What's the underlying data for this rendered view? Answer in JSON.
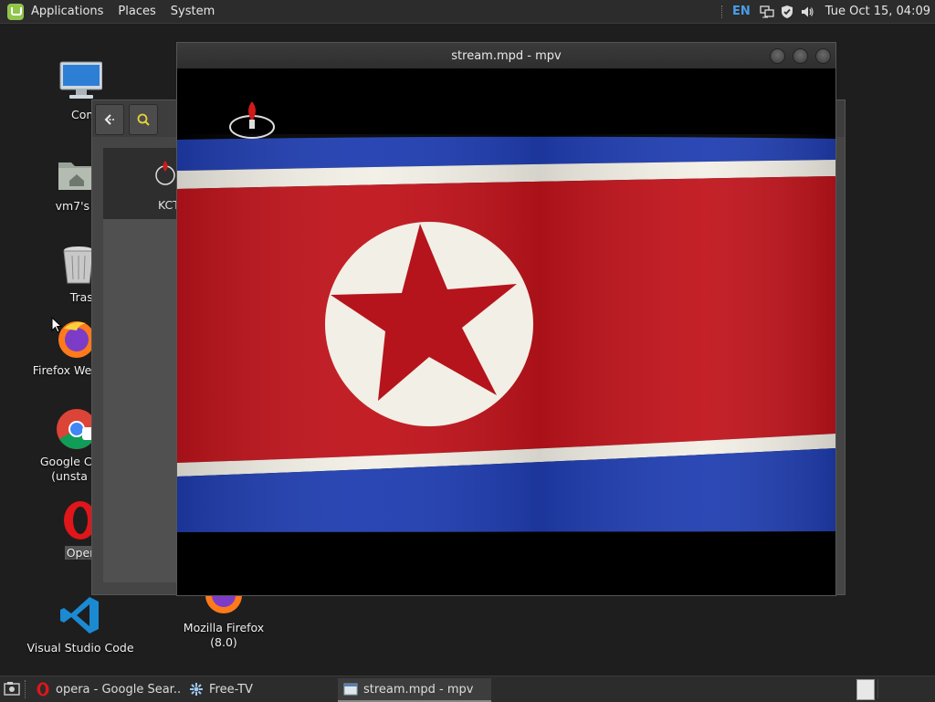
{
  "top_panel": {
    "menus": [
      "Applications",
      "Places",
      "System"
    ],
    "keyboard_layout": "EN",
    "clock": "Tue Oct 15, 04:09"
  },
  "desktop_icons": [
    {
      "label": "Compu",
      "icon": "computer-icon"
    },
    {
      "label": "vm7's H",
      "icon": "home-folder-icon"
    },
    {
      "label": "Trasl",
      "icon": "trash-icon"
    },
    {
      "label": "Firefox Web",
      "icon": "firefox-icon"
    },
    {
      "label": "Google Cl",
      "label2": "(unsta",
      "icon": "chrome-icon"
    },
    {
      "label": "Oper",
      "icon": "opera-icon"
    },
    {
      "label": "Visual Studio Code",
      "icon": "vscode-icon"
    },
    {
      "label": "Mozilla Firefox (8.0)",
      "icon": "firefox-icon"
    }
  ],
  "file_manager": {
    "item_label": "KCT"
  },
  "mpv": {
    "title": "stream.mpd - mpv"
  },
  "taskbar": {
    "items": [
      {
        "label": "opera - Google Sear...",
        "icon": "opera-icon"
      },
      {
        "label": "Free-TV",
        "icon": "freetv-icon"
      },
      {
        "label": "stream.mpd - mpv",
        "icon": "window-icon",
        "active": true
      }
    ]
  },
  "colors": {
    "flag_red": "#c0131b",
    "flag_blue": "#1f3db0",
    "flag_white": "#f2efe6",
    "panel_bg": "#2c2c2c",
    "accent": "#4a9de8"
  }
}
